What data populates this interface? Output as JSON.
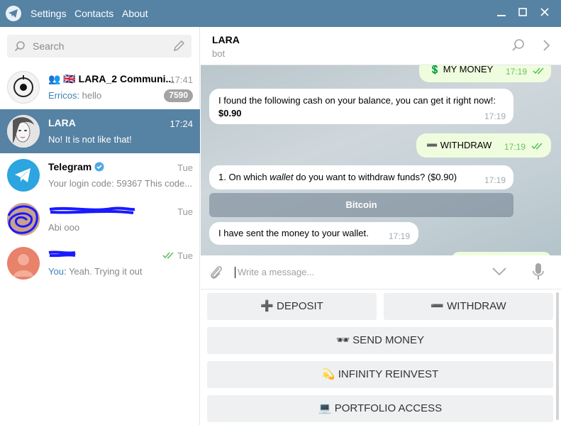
{
  "app": {
    "menu": [
      "Settings",
      "Contacts",
      "About"
    ]
  },
  "search": {
    "placeholder": "Search"
  },
  "chats": [
    {
      "name": "👥 🇬🇧 LARA_2 Communi...",
      "time": "17:41",
      "sender": "Erricos:",
      "message": " hello",
      "badge": "7590"
    },
    {
      "name": "LARA",
      "time": "17:24",
      "message": "No! It is not like that!"
    },
    {
      "name": "Telegram",
      "time": "Tue",
      "message": "Your login code: 59367  This code..."
    },
    {
      "name": "",
      "time": "Tue",
      "message": "Abi ooo"
    },
    {
      "name": "",
      "time": "Tue",
      "sender": "You:",
      "message": " Yeah. Trying it out"
    }
  ],
  "conversation": {
    "name": "LARA",
    "status": "bot"
  },
  "messages": [
    {
      "text": "💲 MY MONEY",
      "time": "17:19"
    },
    {
      "text": "I found the following cash on your balance, you can get it right now!:",
      "amount": "$0.90",
      "time": "17:19"
    },
    {
      "text": "➖ WITHDRAW",
      "time": "17:19"
    },
    {
      "prefix": "1. On which ",
      "emph": "wallet",
      "suffix": " do you want to withdraw funds?  ($0.90)",
      "time": "17:19"
    },
    {
      "text": "I have sent the money to your wallet.",
      "time": "17:19"
    }
  ],
  "inline_button": "Bitcoin",
  "composer": {
    "placeholder": "Write a message..."
  },
  "keyboard": {
    "deposit": "➕ DEPOSIT",
    "withdraw": "➖ WITHDRAW",
    "send_money": "🕶 SEND MONEY",
    "reinvest": "💫 INFINITY REINVEST",
    "portfolio": "💻 PORTFOLIO ACCESS"
  }
}
